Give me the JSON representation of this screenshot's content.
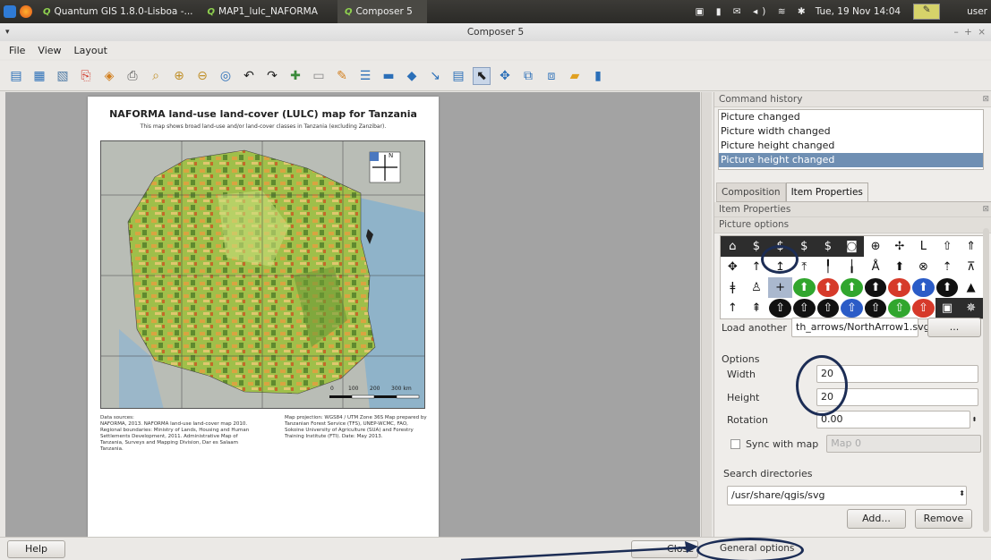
{
  "taskbar": {
    "apps": [
      "Quantum GIS 1.8.0-Lisboa -...",
      "MAP1_lulc_NAFORMA",
      "Composer 5"
    ],
    "clock": "Tue, 19 Nov 14:04",
    "user": "user"
  },
  "window": {
    "title": "Composer 5",
    "controls": "– + ×"
  },
  "menu": [
    "File",
    "View",
    "Layout"
  ],
  "map": {
    "title": "NAFORMA land-use land-cover (LULC) map for Tanzania",
    "subtitle": "This map shows broad land-use and/or land-cover classes in Tanzania (excluding Zanzibar).",
    "scale_labels": [
      "0",
      "100",
      "200",
      "300 km"
    ],
    "north_label": "N",
    "sources_heading": "Data sources:",
    "sources_text": "NAFORMA, 2013.  NAFORMA land-use land-cover map 2010. Regional boundaries: Ministry of Lands, Housing and Human Settlements Development, 2011. Administrative Map of Tanzania, Surveys and Mapping Division, Dar es Salaam Tanzania.",
    "projection_text": "Map projection: WGS84 / UTM Zone 36S Map prepared by Tanzanian Forest Service (TFS), UNEP-WCMC, FAO, Sokoine University of Agriculture (SUA) and Forestry Training Institute (FTI). Date: May 2013."
  },
  "dock": {
    "history_title": "Command history",
    "history": [
      "Picture changed",
      "Picture width changed",
      "Picture height changed",
      "Picture height changed"
    ],
    "tabs": [
      "Composition",
      "Item Properties"
    ],
    "item_properties_title": "Item Properties",
    "picture_options_title": "Picture options",
    "load_another_label": "Load another",
    "load_path": "th_arrows/NorthArrow1.svg",
    "browse_label": "...",
    "options_heading": "Options",
    "width_label": "Width",
    "width_value": "20",
    "height_label": "Height",
    "height_value": "20",
    "rotation_label": "Rotation",
    "rotation_value": "0.00",
    "sync_label": "Sync with map",
    "sync_map_value": "Map 0",
    "search_dirs_heading": "Search directories",
    "search_dir": "/usr/share/qgis/svg",
    "add_label": "Add...",
    "remove_label": "Remove"
  },
  "status": {
    "help_label": "Help",
    "close_label": "Close",
    "general_label": "General options"
  },
  "colors": {
    "accent": "#6f8fb3",
    "ring": "#1c2d55"
  }
}
